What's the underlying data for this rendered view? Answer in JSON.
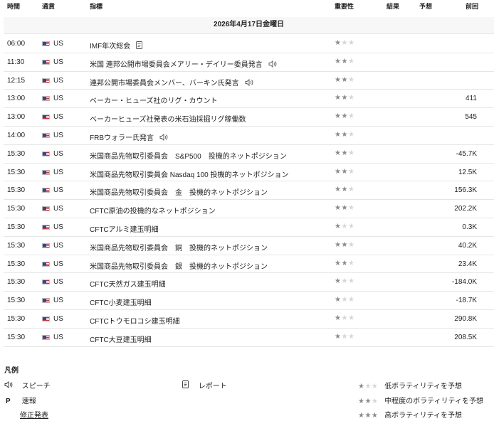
{
  "header": {
    "time": "時間",
    "currency": "通貨",
    "indicator": "指標",
    "importance": "重要性",
    "actual": "結果",
    "forecast": "予想",
    "previous": "前回"
  },
  "date_label": "2026年4月17日金曜日",
  "events": [
    {
      "time": "06:00",
      "currency": "US",
      "name": "IMF年次総会",
      "icon": "report-icon",
      "stars": 1,
      "previous": ""
    },
    {
      "time": "11:30",
      "currency": "US",
      "name": "米国 連邦公開市場委員会メアリー・デイリー委員発言",
      "icon": "speaker-icon",
      "stars": 2,
      "previous": ""
    },
    {
      "time": "12:15",
      "currency": "US",
      "name": "連邦公開市場委員会メンバー、バーキン氏発言",
      "icon": "speaker-icon",
      "stars": 2,
      "previous": ""
    },
    {
      "time": "13:00",
      "currency": "US",
      "name": "ベーカー・ヒューズ社のリグ・カウント",
      "icon": "",
      "stars": 2,
      "previous": "411"
    },
    {
      "time": "13:00",
      "currency": "US",
      "name": "ベーカーヒューズ社発表の米石油採掘リグ稼働数",
      "icon": "",
      "stars": 2,
      "previous": "545"
    },
    {
      "time": "14:00",
      "currency": "US",
      "name": "FRBウォラー氏発言",
      "icon": "speaker-icon",
      "stars": 2,
      "previous": ""
    },
    {
      "time": "15:30",
      "currency": "US",
      "name": "米国商品先物取引委員会　S&P500　投機的ネットポジション",
      "icon": "",
      "stars": 2,
      "previous": "-45.7K"
    },
    {
      "time": "15:30",
      "currency": "US",
      "name": "米国商品先物取引委員会 Nasdaq 100 投機的ネットポジション",
      "icon": "",
      "stars": 2,
      "previous": "12.5K"
    },
    {
      "time": "15:30",
      "currency": "US",
      "name": "米国商品先物取引委員会　金　投機的ネットポジション",
      "icon": "",
      "stars": 2,
      "previous": "156.3K"
    },
    {
      "time": "15:30",
      "currency": "US",
      "name": "CFTC原油の投機的なネットポジション",
      "icon": "",
      "stars": 2,
      "previous": "202.2K"
    },
    {
      "time": "15:30",
      "currency": "US",
      "name": "CFTCアルミ建玉明細",
      "icon": "",
      "stars": 1,
      "previous": "0.3K"
    },
    {
      "time": "15:30",
      "currency": "US",
      "name": "米国商品先物取引委員会　銅　投機的ネットポジション",
      "icon": "",
      "stars": 2,
      "previous": "40.2K"
    },
    {
      "time": "15:30",
      "currency": "US",
      "name": "米国商品先物取引委員会　銀　投機的ネットポジション",
      "icon": "",
      "stars": 2,
      "previous": "23.4K"
    },
    {
      "time": "15:30",
      "currency": "US",
      "name": "CFTC天然ガス建玉明細",
      "icon": "",
      "stars": 1,
      "previous": "-184.0K"
    },
    {
      "time": "15:30",
      "currency": "US",
      "name": "CFTC小麦建玉明細",
      "icon": "",
      "stars": 1,
      "previous": "-18.7K"
    },
    {
      "time": "15:30",
      "currency": "US",
      "name": "CFTCトウモロコシ建玉明細",
      "icon": "",
      "stars": 1,
      "previous": "290.8K"
    },
    {
      "time": "15:30",
      "currency": "US",
      "name": "CFTC大豆建玉明細",
      "icon": "",
      "stars": 1,
      "previous": "208.5K"
    }
  ],
  "legend": {
    "title": "凡例",
    "speech": "スピーチ",
    "flash_symbol": "P",
    "flash": "速報",
    "revised": "修正発表",
    "report": "レポート",
    "low": "低ボラティリティを予想",
    "medium": "中程度のボラティリティを予想",
    "high": "高ボラティリティを予想"
  },
  "colors": {
    "star_on": "#8a8a8a",
    "star_off": "#d6d6d6",
    "row_border": "#e6e6e6",
    "date_bg": "#f7f7f7"
  }
}
